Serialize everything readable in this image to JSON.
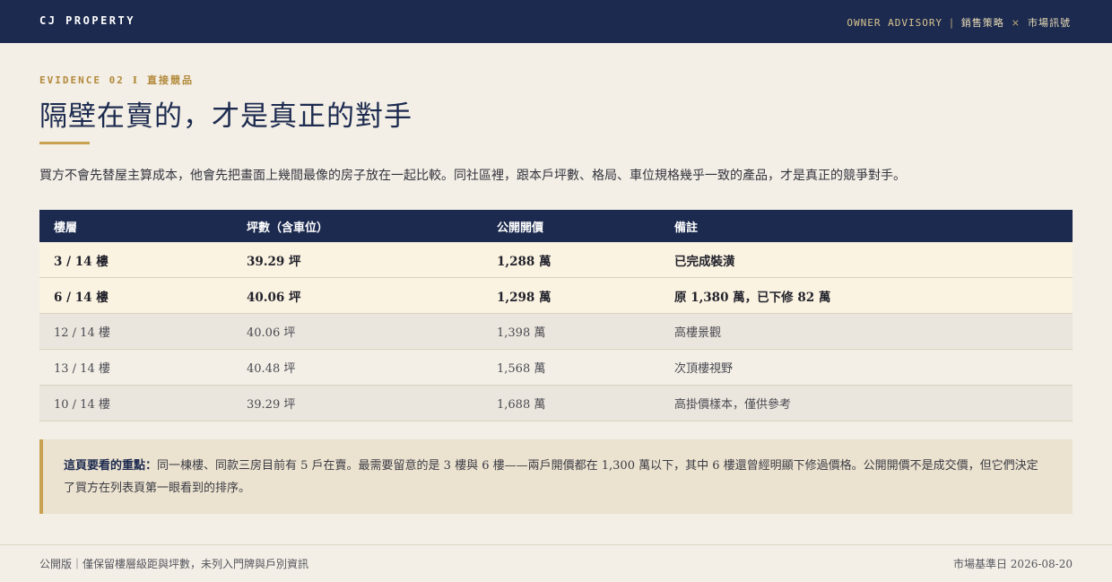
{
  "header": {
    "brand": "CJ PROPERTY",
    "advisory_en": "OWNER ADVISORY",
    "advisory_divider": "|",
    "advisory_cn_1": "銷售策略",
    "advisory_x": "×",
    "advisory_cn_2": "市場訊號"
  },
  "section": {
    "eyebrow_en": "EVIDENCE 02",
    "eyebrow_divider": "I",
    "eyebrow_cn": "直接競品",
    "title": "隔壁在賣的，才是真正的對手",
    "intro": "買方不會先替屋主算成本，他會先把畫面上幾間最像的房子放在一起比較。同社區裡，跟本戶坪數、格局、車位規格幾乎一致的產品，才是真正的競爭對手。"
  },
  "table": {
    "headers": [
      "樓層",
      "坪數（含車位）",
      "公開開價",
      "備註"
    ],
    "rows": [
      {
        "floor": "3 / 14 樓",
        "ping": "39.29 坪",
        "price": "1,288 萬",
        "note": "已完成裝潢"
      },
      {
        "floor": "6 / 14 樓",
        "ping": "40.06 坪",
        "price": "1,298 萬",
        "note": "原 1,380 萬，已下修 82 萬"
      },
      {
        "floor": "12 / 14 樓",
        "ping": "40.06 坪",
        "price": "1,398 萬",
        "note": "高樓景觀"
      },
      {
        "floor": "13 / 14 樓",
        "ping": "40.48 坪",
        "price": "1,568 萬",
        "note": "次頂樓視野"
      },
      {
        "floor": "10 / 14 樓",
        "ping": "39.29 坪",
        "price": "1,688 萬",
        "note": "高掛價樣本，僅供參考"
      }
    ]
  },
  "callout": {
    "lead": "這頁要看的重點：",
    "body": "同一棟樓、同款三房目前有 5 戶在賣。最需要留意的是 3 樓與 6 樓——兩戶開價都在 1,300 萬以下，其中 6 樓還曾經明顯下修過價格。公開開價不是成交價，但它們決定了買方在列表頁第一眼看到的排序。"
  },
  "footer": {
    "left": "公開版｜僅保留樓層級距與坪數，未列入門牌與戶別資訊",
    "right": "市場基準日 2026-08-20"
  },
  "colors": {
    "navy": "#1c2a4f",
    "gold": "#c9a251",
    "background": "#f3efe6",
    "highlight_row": "#fbf3e1"
  }
}
